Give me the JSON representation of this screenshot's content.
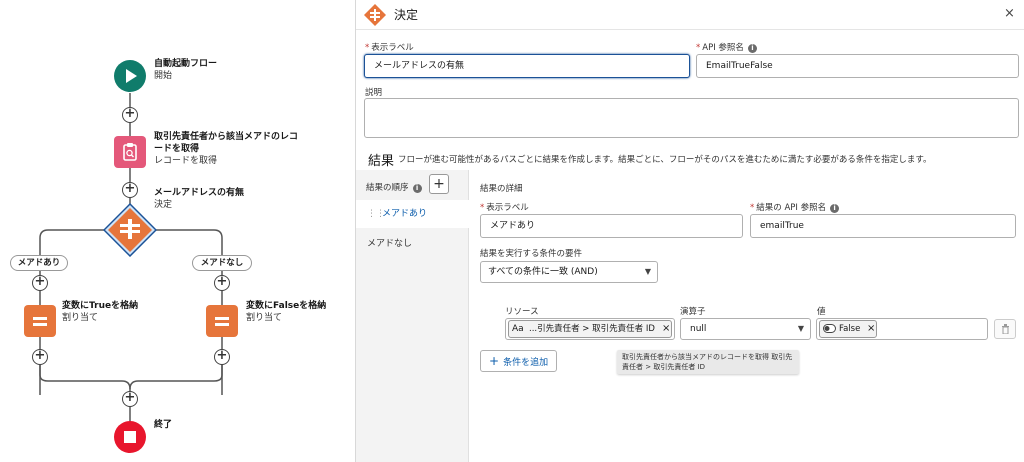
{
  "flow": {
    "start": {
      "title": "自動起動フロー",
      "subtitle": "開始"
    },
    "get_records": {
      "title_line1": "取引先責任者から該当メアドのレコ",
      "title_line2": "ードを取得",
      "subtitle": "レコードを取得"
    },
    "decision": {
      "title": "メールアドレスの有無",
      "subtitle": "決定"
    },
    "branch_left": {
      "label": "メアドあり"
    },
    "branch_right": {
      "label": "メアドなし"
    },
    "assign_true": {
      "title": "変数にTrueを格納",
      "subtitle": "割り当て"
    },
    "assign_false": {
      "title": "変数にFalseを格納",
      "subtitle": "割り当て"
    },
    "end": {
      "title": "終了"
    },
    "add_symbol": "+"
  },
  "panel": {
    "title": "決定",
    "close": "×",
    "label_field": {
      "label": "表示ラベル",
      "value": "メールアドレスの有無"
    },
    "api_field": {
      "label": "API 参照名",
      "value": "EmailTrueFalse"
    },
    "description_field": {
      "label": "説明",
      "value": ""
    },
    "info_glyph": "i",
    "required_mark": "*"
  },
  "outcomes": {
    "title": "結果",
    "description": "フローが進む可能性があるパスごとに結果を作成します。結果ごとに、フローがそのパスを進むために満たす必要がある条件を指定します。",
    "order_label": "結果の順序",
    "add_symbol": "+",
    "items": [
      {
        "label": "メアドあり"
      },
      {
        "label": "メアドなし"
      }
    ],
    "grip": "⋮⋮"
  },
  "details": {
    "heading": "結果の詳細",
    "label_field": {
      "label": "表示ラベル",
      "value": "メアドあり"
    },
    "api_field": {
      "label": "結果の API 参照名",
      "value": "emailTrue"
    },
    "requirement": {
      "label": "結果を実行する条件の要件",
      "value": "すべての条件に一致 (AND)"
    },
    "condition": {
      "resource_label": "リソース",
      "operator_label": "演算子",
      "value_label": "値",
      "resource_value": "...引先責任者 > 取引先責任者 ID",
      "resource_icon_text": "Aa",
      "operator_value": "null",
      "value_chip": "False",
      "remove_glyph": "×",
      "caret": "▼"
    },
    "add_condition": "条件を追加",
    "add_condition_symbol": "+",
    "tooltip": "取引先責任者から該当メアドのレコードを取得 取引先責任者 > 取引先責任者 ID"
  },
  "colors": {
    "start": "#107c6b",
    "get_records": "#e4587a",
    "decision": "#e6753b",
    "assignment": "#e6753b",
    "end": "#e8162d",
    "focus": "#1b5297",
    "link": "#0b5cab"
  }
}
